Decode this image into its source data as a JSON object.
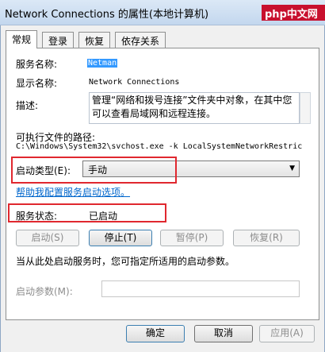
{
  "window": {
    "title": "Network Connections 的属性(本地计算机)",
    "watermark": "php中文网"
  },
  "tabs": [
    {
      "label": "常规",
      "active": true
    },
    {
      "label": "登录",
      "active": false
    },
    {
      "label": "恢复",
      "active": false
    },
    {
      "label": "依存关系",
      "active": false
    }
  ],
  "general": {
    "service_name_label": "服务名称:",
    "service_name_value": "Netman",
    "display_name_label": "显示名称:",
    "display_name_value": "Network Connections",
    "description_label": "描述:",
    "description_value": "管理“网络和拨号连接”文件夹中对象，在其中您可以查看局域网和远程连接。",
    "exe_path_label": "可执行文件的路径:",
    "exe_path_value": "C:\\Windows\\System32\\svchost.exe -k LocalSystemNetworkRestric",
    "startup_type_label": "启动类型(E):",
    "startup_type_value": "手动",
    "help_link": "帮助我配置服务启动选项。",
    "status_label": "服务状态:",
    "status_value": "已启动",
    "buttons": {
      "start": "启动(S)",
      "stop": "停止(T)",
      "pause": "暂停(P)",
      "resume": "恢复(R)"
    },
    "start_params_hint": "当从此处启动服务时，您可指定所适用的启动参数。",
    "start_params_label": "启动参数(M):",
    "start_params_value": ""
  },
  "footer": {
    "ok": "确定",
    "cancel": "取消",
    "apply": "应用(A)"
  },
  "colors": {
    "highlight": "#e0282f",
    "link": "#0066cc",
    "selection": "#3399ff"
  }
}
